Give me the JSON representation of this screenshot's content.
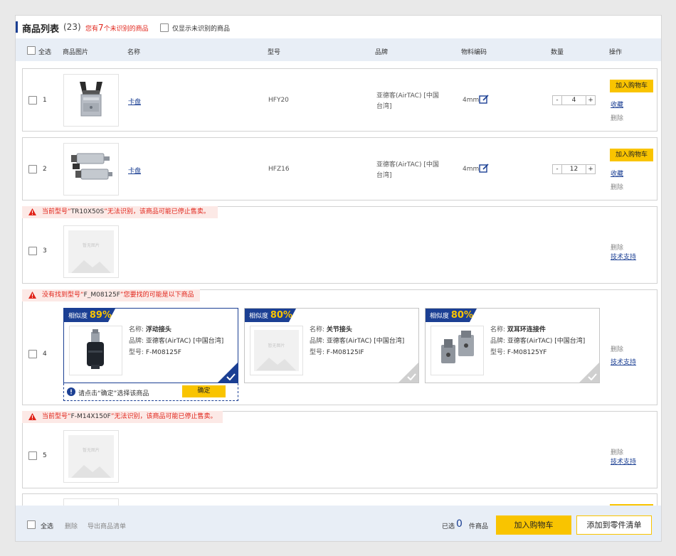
{
  "title": {
    "label": "商品列表",
    "count": "(23)",
    "unrecognized_pre": "您有",
    "unrecognized_num": "7",
    "unrecognized_post": "个未识别的商品",
    "filter_label": "仅显示未识别的商品"
  },
  "columns": {
    "select_all": "全选",
    "image": "商品图片",
    "name": "名称",
    "model": "型号",
    "brand": "品牌",
    "material_code": "物料编码",
    "quantity": "数量",
    "actions": "操作"
  },
  "rows": [
    {
      "index": "1",
      "name": "卡盘",
      "model": "HFY20",
      "brand": "亚德客(AirTAC) [中国台湾]",
      "code": "4mm",
      "qty": "4",
      "add_cart": "加入购物车",
      "favorite": "收藏",
      "delete": "删除"
    },
    {
      "index": "2",
      "name": "卡盘",
      "model": "HFZ16",
      "brand": "亚德客(AirTAC) [中国台湾]",
      "code": "4mm",
      "qty": "12",
      "add_cart": "加入购物车",
      "favorite": "收藏",
      "delete": "删除"
    }
  ],
  "row3": {
    "warning_pre": "当前型号“",
    "warning_model": "TR10X50S",
    "warning_post": "”无法识别，该商品可能已停止售卖。",
    "index": "3",
    "no_image": "暂无图片",
    "delete": "删除",
    "support": "技术支持"
  },
  "row4": {
    "warning_pre": "没有找到型号“",
    "warning_model": "F_M08125F",
    "warning_post": "”您要找的可能是以下商品",
    "index": "4",
    "name_key": "名称:",
    "brand_key": "品牌:",
    "model_key": "型号:",
    "sim_label": "相似度",
    "candidates": [
      {
        "similarity": "89%",
        "name": "浮动接头",
        "brand": "亚德客(AirTAC) [中国台湾]",
        "model": "F-M08125F"
      },
      {
        "similarity": "80%",
        "name": "关节接头",
        "brand": "亚德客(AirTAC) [中国台湾]",
        "model": "F-M08125IF"
      },
      {
        "similarity": "80%",
        "name": "双耳环连接件",
        "brand": "亚德客(AirTAC) [中国台湾]",
        "model": "F-M08125YF"
      }
    ],
    "confirm_hint": "请点击“确定”选择该商品",
    "confirm": "确定",
    "no_image": "暂无图片",
    "delete": "删除",
    "support": "技术支持"
  },
  "row5": {
    "warning_pre": "当前型号“",
    "warning_model": "F-M14X150F",
    "warning_post": "”无法识别，该商品可能已停止售卖。",
    "index": "5",
    "no_image": "暂无图片",
    "delete": "删除",
    "support": "技术支持"
  },
  "footer": {
    "select_all": "全选",
    "delete": "删除",
    "export": "导出商品清单",
    "selected_pre": "已选",
    "selected_count": "0",
    "selected_post": "件商品",
    "add_cart": "加入购物车",
    "add_parts": "添加到零件清单"
  },
  "colors": {
    "brand_blue": "#1b3f93",
    "accent_yellow": "#f9c400",
    "warning_red": "#e1251b",
    "header_bg": "#e8eef6"
  },
  "icons": [
    "edit-icon",
    "warning-icon",
    "info-icon",
    "check-icon"
  ]
}
